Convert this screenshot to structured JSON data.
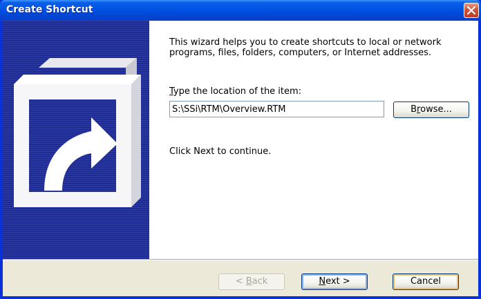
{
  "window": {
    "title": "Create Shortcut",
    "close_icon": "close-x-icon",
    "title_bar_color": "#0053e5",
    "close_button_color": "#d0543a"
  },
  "banner": {
    "icon": "shortcut-arrow-icon",
    "color": "#1c2a95"
  },
  "content": {
    "description": "This wizard helps you to create shortcuts to local or network programs, files, folders, computers, or Internet addresses.",
    "location_label": "Type the location of the item:",
    "location_label_access_key": "T",
    "location_value": "S:\\SSi\\RTM\\Overview.RTM",
    "browse_label": "Browse...",
    "browse_access_key": "r",
    "continue_text": "Click Next to continue."
  },
  "footer": {
    "back_label": "< Back",
    "back_access_key": "B",
    "next_label": "Next >",
    "next_access_key": "N",
    "cancel_label": "Cancel"
  }
}
